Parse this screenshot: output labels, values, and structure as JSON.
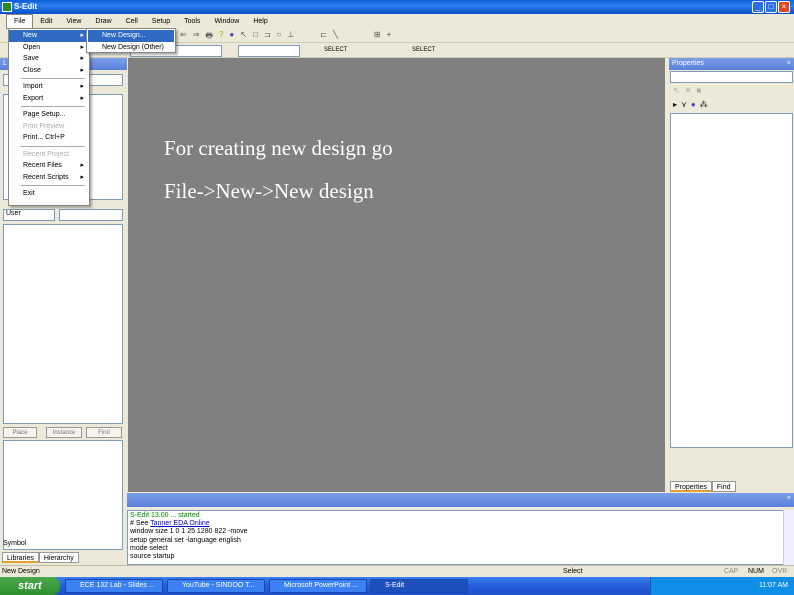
{
  "window": {
    "title": "S-Edit"
  },
  "menubar": [
    "File",
    "Edit",
    "View",
    "Draw",
    "Cell",
    "Setup",
    "Tools",
    "Window",
    "Help"
  ],
  "file_menu": {
    "items": [
      {
        "label": "New",
        "submenu": true
      },
      {
        "label": "Open",
        "submenu": true
      },
      {
        "label": "Save",
        "submenu": true
      },
      {
        "label": "Close",
        "submenu": true
      },
      {
        "label": "Import",
        "submenu": true
      },
      {
        "label": "Export",
        "submenu": true
      },
      {
        "label": "Page Setup..."
      },
      {
        "label": "Print Preview",
        "disabled": true
      },
      {
        "label": "Print...    Ctrl+P"
      },
      {
        "label": "Recent Project",
        "disabled": true
      },
      {
        "label": "Recent Files",
        "submenu": true
      },
      {
        "label": "Recent Scripts",
        "submenu": true
      },
      {
        "label": "Exit"
      }
    ]
  },
  "new_submenu": [
    "New Design...",
    "New Design (Other)"
  ],
  "toolbar": {
    "select_combo_1": "SELECT",
    "select_combo_2": "SELECT"
  },
  "canvas": {
    "line1": "For creating new design go",
    "line2": "File->New->New design",
    "background": "#808080"
  },
  "left_panel": {
    "title": "L",
    "filter_value": "User",
    "buttons": [
      "Place",
      "Instance",
      "Find"
    ],
    "symbol_label": "Symbol",
    "tabs": [
      "Libraries",
      "Hierarchy"
    ]
  },
  "properties": {
    "title": "Properties",
    "tabs": [
      "Properties",
      "Find"
    ]
  },
  "command": {
    "lines": [
      {
        "text": "S-Edit 13.00 ... started",
        "green": true
      },
      {
        "text": "# See ",
        "link": "Tanner EDA Online"
      },
      {
        "text": "window size 1 0 1 25 1280 822 -move"
      },
      {
        "text": "setup general set -language english"
      },
      {
        "text": "mode select"
      },
      {
        "text": "source startup"
      }
    ]
  },
  "status": {
    "left": "New Design",
    "mid": "Select",
    "indicators": [
      "CAP",
      "NUM",
      "OVR"
    ]
  },
  "taskbar": {
    "start": "start",
    "tasks": [
      "ECE 132 Lab - Slides ...",
      "YouTube - SINDOO T...",
      "Microsoft PowerPoint ...",
      "S-Edit"
    ],
    "clock": "11:07 AM"
  },
  "colors": {
    "accent": "#316ac5",
    "titlebar": "#0a5fd8",
    "taskbar": "#245edb"
  }
}
